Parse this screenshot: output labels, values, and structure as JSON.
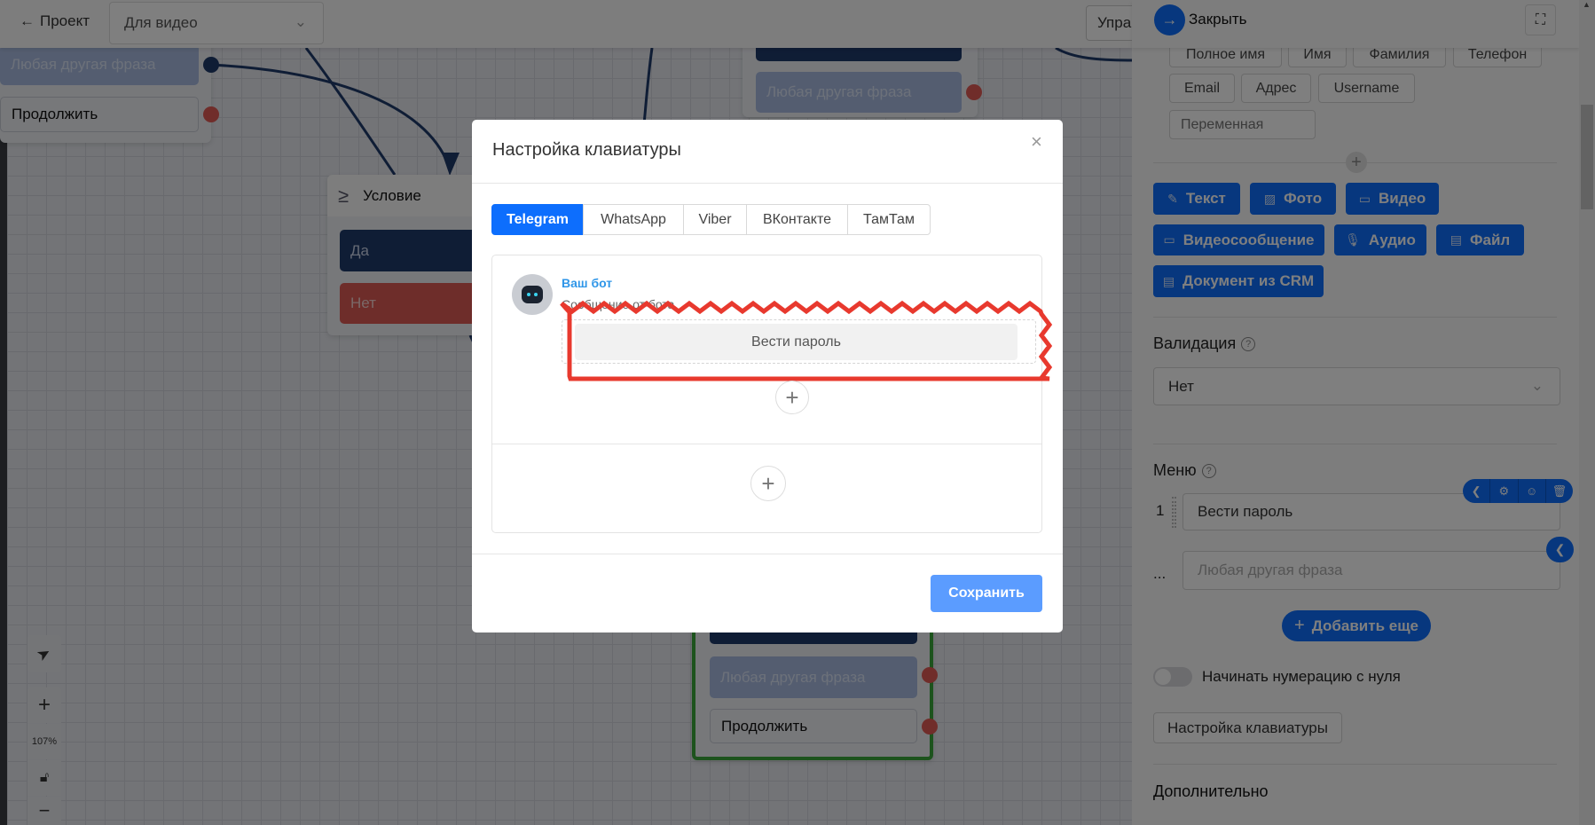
{
  "topbar": {
    "back_label": "Проект",
    "project_select": "Для видео",
    "manage_button": "Упра"
  },
  "canvas": {
    "node_top_left": {
      "options": [
        "Любая другая фраза",
        "Продолжить"
      ]
    },
    "condition_node": {
      "title": "Условие",
      "options": [
        "Да",
        "Нет"
      ]
    },
    "node_top_center": {
      "options": [
        "Любая другая фраза"
      ]
    },
    "node_bottom": {
      "options": [
        "Любая другая фраза",
        "Продолжить"
      ]
    },
    "zoom_level": "107%"
  },
  "panel": {
    "close_label": "Закрыть",
    "variable_chips": [
      "Полное имя",
      "Имя",
      "Фамилия",
      "Телефон",
      "Email",
      "Адрес",
      "Username"
    ],
    "variable_placeholder": "Переменная",
    "content_buttons": [
      {
        "label": "Текст",
        "icon": "pencil-icon"
      },
      {
        "label": "Фото",
        "icon": "image-icon"
      },
      {
        "label": "Видео",
        "icon": "video-icon"
      },
      {
        "label": "Видеосообщение",
        "icon": "video-icon"
      },
      {
        "label": "Аудио",
        "icon": "microphone-icon"
      },
      {
        "label": "Файл",
        "icon": "file-icon"
      },
      {
        "label": "Документ из CRM",
        "icon": "document-icon"
      }
    ],
    "validation_label": "Валидация",
    "validation_value": "Нет",
    "menu_label": "Меню",
    "menu_items": [
      {
        "number": "1",
        "value": "Вести пароль"
      }
    ],
    "menu_other_marker": "...",
    "menu_other_placeholder": "Любая другая фраза",
    "add_more_label": "Добавить еще",
    "zero_numbering_label": "Начинать нумерацию с нуля",
    "zero_numbering_on": false,
    "keyboard_settings_label": "Настройка клавиатуры",
    "additional_label": "Дополнительно"
  },
  "modal": {
    "title": "Настройка клавиатуры",
    "tabs": [
      "Telegram",
      "WhatsApp",
      "Viber",
      "ВКонтакте",
      "ТамТам"
    ],
    "active_tab": "Telegram",
    "bot_name": "Ваш бот",
    "bot_message": "Сообщение от бота",
    "keyboard_button": "Вести пароль",
    "save_label": "Сохранить"
  },
  "colors": {
    "primary": "#0d6efd",
    "save": "#5b9cff",
    "highlight": "#e8392e",
    "node_navy": "#1f3a6b",
    "node_red": "#dc5a55",
    "bottom_node_border": "#3aa63a"
  }
}
